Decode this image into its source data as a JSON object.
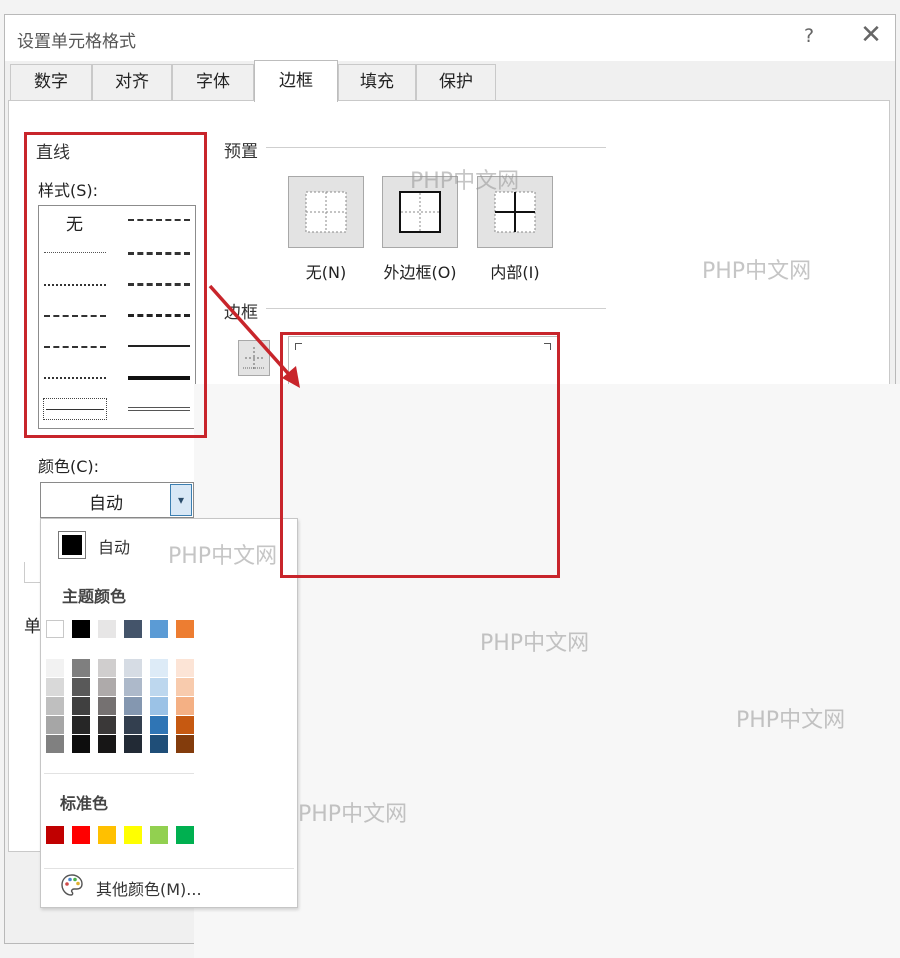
{
  "dialog": {
    "title": "设置单元格格式",
    "help_label": "?",
    "close_label": "✕"
  },
  "tabs": [
    {
      "label": "数字"
    },
    {
      "label": "对齐"
    },
    {
      "label": "字体"
    },
    {
      "label": "边框",
      "active": true
    },
    {
      "label": "填充"
    },
    {
      "label": "保护"
    }
  ],
  "line_section": {
    "title": "直线",
    "style_label": "样式(S):",
    "none_option": "无",
    "styles": [
      "none",
      "dash-dot-dot",
      "hair",
      "medium-dash-dot-dot",
      "dotted",
      "medium-dash-dot",
      "dash-dot",
      "medium-dashed",
      "dash-dot",
      "thin",
      "dotted-fine",
      "medium",
      "double",
      "thick"
    ]
  },
  "presets": {
    "title": "预置",
    "items": [
      {
        "label": "无(N)",
        "icon": "preset-none-icon"
      },
      {
        "label": "外边框(O)",
        "icon": "preset-outline-icon"
      },
      {
        "label": "内部(I)",
        "icon": "preset-inside-icon"
      }
    ]
  },
  "border_section": {
    "title": "边框"
  },
  "color": {
    "label": "颜色(C):",
    "selected": "自动",
    "dropdown_arrow": "▾",
    "auto_label": "自动",
    "theme_title": "主题颜色",
    "theme_colors": [
      "#ffffff",
      "#000000",
      "#e7e6e6",
      "#44546a",
      "#5b9bd5",
      "#ed7d31"
    ],
    "theme_shades": [
      [
        "#f2f2f2",
        "#d9d9d9",
        "#bfbfbf",
        "#a6a6a6",
        "#808080"
      ],
      [
        "#7f7f7f",
        "#595959",
        "#404040",
        "#262626",
        "#0d0d0d"
      ],
      [
        "#d0cece",
        "#aeaaaa",
        "#757171",
        "#3a3838",
        "#171616"
      ],
      [
        "#d6dce4",
        "#adb9ca",
        "#8497b0",
        "#333f4f",
        "#222a35"
      ],
      [
        "#ddebf7",
        "#bdd7ee",
        "#9bc2e6",
        "#2f75b5",
        "#1f4e78"
      ],
      [
        "#fce4d6",
        "#f8cbad",
        "#f4b084",
        "#c65911",
        "#833c0c"
      ]
    ],
    "standard_title": "标准色",
    "standard_colors": [
      "#c00000",
      "#ff0000",
      "#ffc000",
      "#ffff00",
      "#92d050",
      "#00b050"
    ],
    "more_colors": "其他颜色(M)..."
  },
  "partial_label": "单",
  "watermark": "PHP中文网",
  "accent_colors": {
    "annotation": "#c8252b",
    "dropdown_button": "#3c7fb1"
  }
}
